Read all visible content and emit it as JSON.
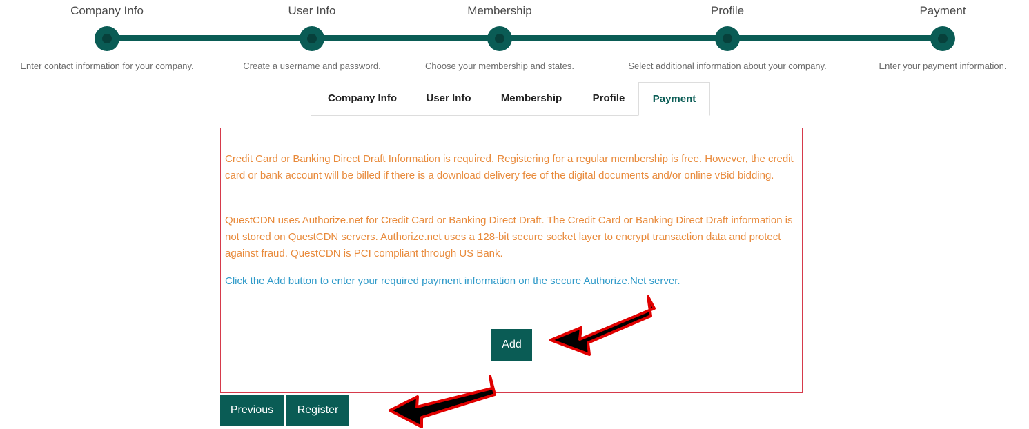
{
  "steps": [
    {
      "title": "Company Info",
      "description": "Enter contact information for your company."
    },
    {
      "title": "User Info",
      "description": "Create a username and password."
    },
    {
      "title": "Membership",
      "description": "Choose your membership and states."
    },
    {
      "title": "Profile",
      "description": "Select additional information about your company."
    },
    {
      "title": "Payment",
      "description": "Enter your payment information."
    }
  ],
  "tabs": [
    {
      "label": "Company Info"
    },
    {
      "label": "User Info"
    },
    {
      "label": "Membership"
    },
    {
      "label": "Profile"
    },
    {
      "label": "Payment",
      "active": true
    }
  ],
  "payment": {
    "paragraph1": "Credit Card or Banking Direct Draft Information is required. Registering for a regular membership is free. However, the credit card or bank account will be billed if there is a download delivery fee of the digital documents and/or online vBid bidding.",
    "paragraph2": "QuestCDN uses Authorize.net for Credit Card or Banking Direct Draft. The Credit Card or Banking Direct Draft information is not stored on QuestCDN servers. Authorize.net uses a 128-bit secure socket layer to encrypt transaction data and protect against fraud. QuestCDN is PCI compliant through US Bank.",
    "paragraph3": "Click the Add button to enter your required payment information on the secure Authorize.Net server.",
    "add_label": "Add"
  },
  "nav": {
    "previous_label": "Previous",
    "register_label": "Register"
  },
  "colors": {
    "brand": "#0a5c55",
    "notice_text": "#e88a3b",
    "link_text": "#2f9ac9",
    "panel_border": "#d63a4b"
  }
}
